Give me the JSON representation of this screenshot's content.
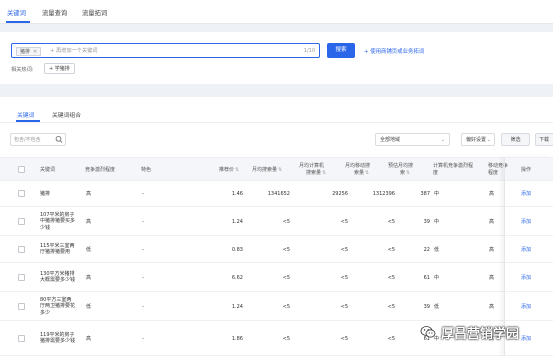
{
  "top_tabs": [
    "关键词",
    "流量查询",
    "流量拓词"
  ],
  "search": {
    "tag": "猪排",
    "placeholder": "+ 再增加一个关键词",
    "counter": "1/10",
    "button": "搜索",
    "merchant_link": "+ 使用商铺页或业务拓词",
    "related_label": "相关热词:",
    "related_chip": "+ 学猪排"
  },
  "sub_tabs": [
    "关键词",
    "关键词组合"
  ],
  "toolbar": {
    "filter_placeholder": "包含/不包含",
    "region": "全部地域",
    "sort": "偏好设置",
    "filter": "筛选",
    "download": "下载"
  },
  "columns": {
    "keyword": "关键词",
    "competition": "竞争激烈程度",
    "feature": "特色",
    "recommend_price": "推荐价",
    "monthly_search": "月均搜索量",
    "monthly_pc_search": [
      "月均计算机",
      "搜索量"
    ],
    "monthly_mobile_search": [
      "月均移动搜",
      "索量"
    ],
    "daily_est": [
      "预估月均搜",
      "索"
    ],
    "pc_competition": [
      "计算机竞争激烈程",
      "度"
    ],
    "mobile_competition": [
      "移动竞争",
      "程度"
    ],
    "action": "操作"
  },
  "rows": [
    {
      "keyword": [
        "猪排"
      ],
      "competition": "高",
      "feature": "-",
      "price": "1.46",
      "monthly": "1341652",
      "pc": "29256",
      "mobile": "1312396",
      "est": "387",
      "pc_comp": "中",
      "mobile_comp": "高",
      "action": "添加"
    },
    {
      "keyword": [
        "107平米的房子",
        "中猪排猪要买多",
        "少钱"
      ],
      "competition": "高",
      "feature": "-",
      "price": "1.24",
      "monthly": "<5",
      "pc": "<5",
      "mobile": "<5",
      "est": "39",
      "pc_comp": "中",
      "mobile_comp": "高",
      "action": "添加"
    },
    {
      "keyword": [
        "115平米三室两",
        "厅猪排猪要用"
      ],
      "competition": "低",
      "feature": "-",
      "price": "0.83",
      "monthly": "<5",
      "pc": "<5",
      "mobile": "<5",
      "est": "22",
      "pc_comp": "低",
      "mobile_comp": "高",
      "action": "添加"
    },
    {
      "keyword": [
        "130平方米猪排",
        "大概需要多少钱"
      ],
      "competition": "高",
      "feature": "-",
      "price": "6.62",
      "monthly": "<5",
      "pc": "<5",
      "mobile": "<5",
      "est": "61",
      "pc_comp": "中",
      "mobile_comp": "高",
      "action": "添加"
    },
    {
      "keyword": [
        "80平方三室两",
        "厅两卫猪排要花",
        "多少"
      ],
      "competition": "低",
      "feature": "-",
      "price": "1.24",
      "monthly": "<5",
      "pc": "<5",
      "mobile": "<5",
      "est": "39",
      "pc_comp": "低",
      "mobile_comp": "高",
      "action": "添加"
    },
    {
      "keyword": [
        "119平米的房子",
        "猪排需要多少钱"
      ],
      "competition": "高",
      "feature": "-",
      "price": "1.86",
      "monthly": "<5",
      "pc": "<5",
      "mobile": "<5",
      "est": "61",
      "pc_comp": "中",
      "mobile_comp": "高",
      "action": "添加"
    }
  ],
  "watermark": "厚昌营销学园",
  "colors": {
    "accent": "#2a66e8",
    "header_bg": "#f5f6f9",
    "page_bg": "#eef1f5"
  },
  "icons": {
    "search": "search-icon",
    "close": "close-icon",
    "chevron": "chevron-down-icon",
    "sort": "sort-icon",
    "wechat": "wechat-icon"
  }
}
